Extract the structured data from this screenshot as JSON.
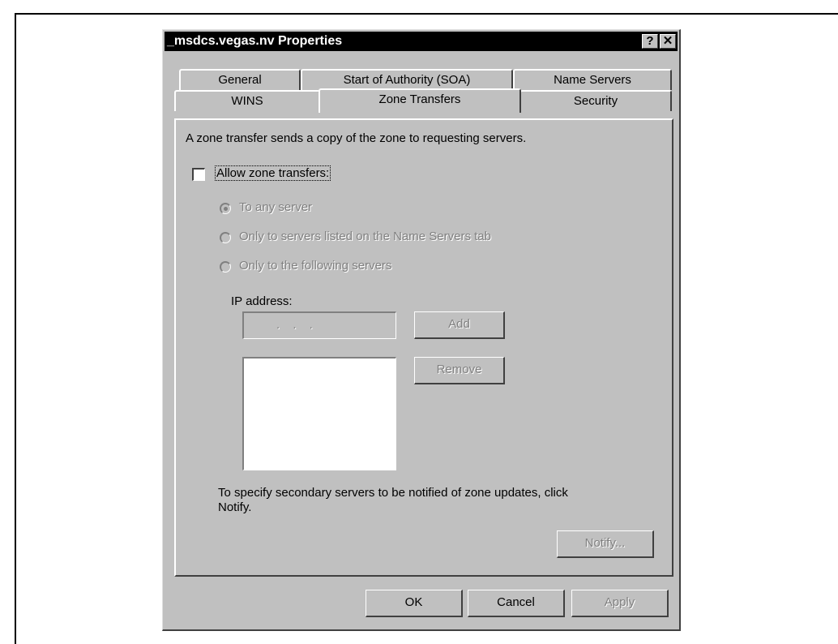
{
  "window": {
    "title": "_msdcs.vegas.nv Properties",
    "help_glyph": "?",
    "close_glyph": "✕"
  },
  "tabs": {
    "row1": [
      "General",
      "Start of Authority (SOA)",
      "Name Servers"
    ],
    "row2": [
      "WINS",
      "Zone Transfers",
      "Security"
    ],
    "active": "Zone Transfers"
  },
  "zone_transfers": {
    "description": "A zone transfer sends a copy of the zone to requesting servers.",
    "allow_checkbox": {
      "label": "Allow zone transfers:",
      "checked": false
    },
    "options": [
      {
        "label": "To any server",
        "selected": true
      },
      {
        "label": "Only to servers listed on the Name Servers tab",
        "selected": false
      },
      {
        "label": "Only to the following servers",
        "selected": false
      }
    ],
    "ip_label": "IP address:",
    "ip_placeholder": ".   .   .",
    "add_label": "Add",
    "remove_label": "Remove",
    "notify_text_line1": "To specify secondary servers to be notified of zone updates, click",
    "notify_text_line2": "Notify.",
    "notify_label": "Notify..."
  },
  "footer": {
    "ok_label": "OK",
    "cancel_label": "Cancel",
    "apply_label": "Apply"
  }
}
